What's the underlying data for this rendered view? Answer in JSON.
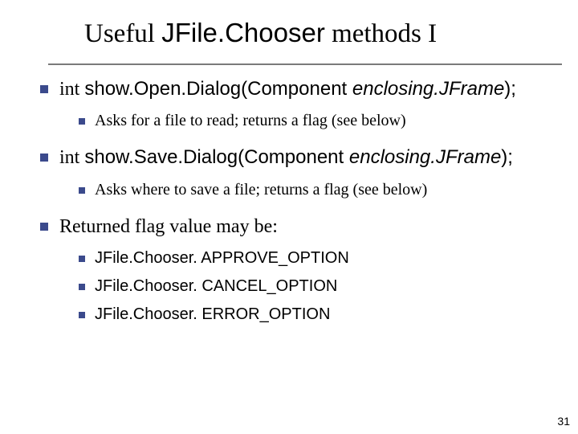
{
  "title": {
    "t1": "Useful ",
    "code": "JFile.Chooser",
    "t2": " methods I"
  },
  "items": [
    {
      "prefix": "int ",
      "code1": "show.Open.Dialog(Component ",
      "ital": "enclosing.JFrame",
      "code2": ");",
      "sub": [
        "Asks for a file to read; returns a flag (see below)"
      ]
    },
    {
      "prefix": "int ",
      "code1": "show.Save.Dialog(Component ",
      "ital": "enclosing.JFrame",
      "code2": ");",
      "sub": [
        "Asks where to save a file; returns a flag (see below)"
      ]
    },
    {
      "text": "Returned flag value may be:",
      "sub": [
        "JFile.Chooser. APPROVE_OPTION",
        "JFile.Chooser. CANCEL_OPTION",
        "JFile.Chooser. ERROR_OPTION"
      ],
      "subSans": true
    }
  ],
  "pageNumber": "31"
}
